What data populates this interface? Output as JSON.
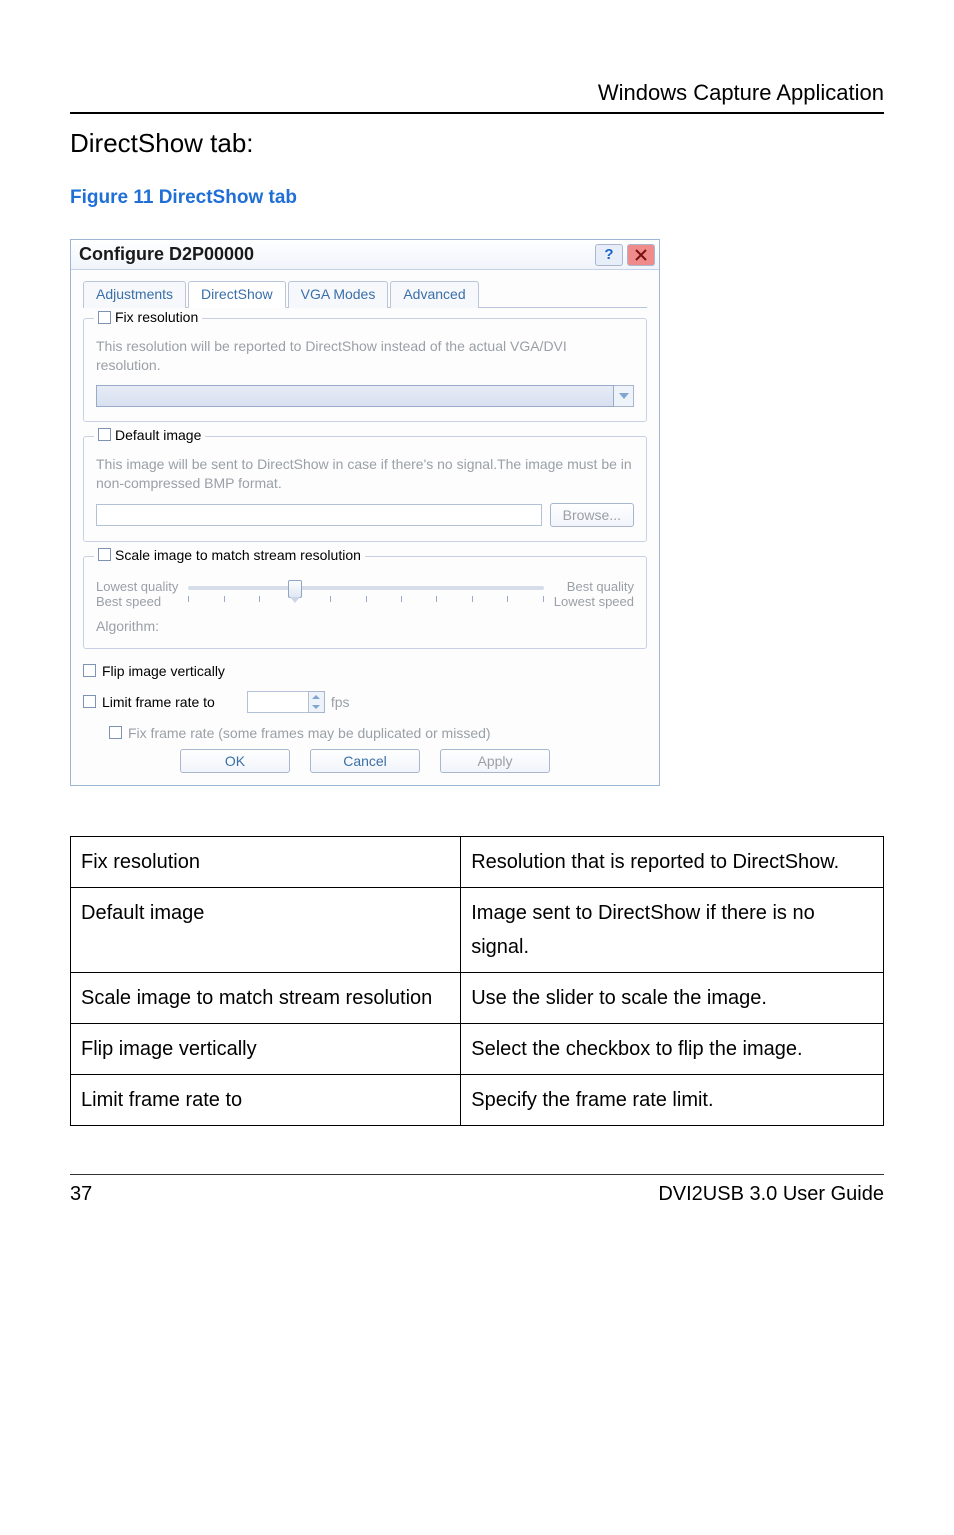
{
  "header": {
    "right": "Windows Capture Application"
  },
  "section_title": "DirectShow tab:",
  "figure_caption": "Figure 11 DirectShow tab",
  "dialog": {
    "title": "Configure D2P00000",
    "tabs": [
      "Adjustments",
      "DirectShow",
      "VGA Modes",
      "Advanced"
    ],
    "active_tab": 1,
    "fix_resolution": {
      "legend": "Fix resolution",
      "desc": "This resolution will be reported to DirectShow instead of the actual VGA/DVI resolution."
    },
    "default_image": {
      "legend": "Default image",
      "desc": "This image will be sent to DirectShow in case if there's no signal.The image must be in non-compressed BMP format.",
      "browse": "Browse..."
    },
    "scale": {
      "legend": "Scale image to match stream resolution",
      "left_top": "Lowest quality",
      "left_bottom": "Best speed",
      "right_top": "Best quality",
      "right_bottom": "Lowest speed",
      "algo_label": "Algorithm:"
    },
    "flip_label": "Flip image vertically",
    "limit_label": "Limit frame rate to",
    "fps_label": "fps",
    "fix_frame_rate": "Fix frame rate (some frames may be duplicated or missed)",
    "ok": "OK",
    "cancel": "Cancel",
    "apply": "Apply"
  },
  "table": {
    "rows": [
      [
        "Fix resolution",
        "Resolution that is reported to DirectShow."
      ],
      [
        "Default image",
        "Image sent to DirectShow if there is no signal."
      ],
      [
        "Scale image to match stream resolution",
        "Use the slider to scale the image."
      ],
      [
        "Flip image vertically",
        "Select the checkbox to flip the image."
      ],
      [
        "Limit frame rate to",
        "Specify the frame rate limit."
      ]
    ]
  },
  "footer": {
    "page": "37",
    "guide": "DVI2USB 3.0  User Guide"
  }
}
